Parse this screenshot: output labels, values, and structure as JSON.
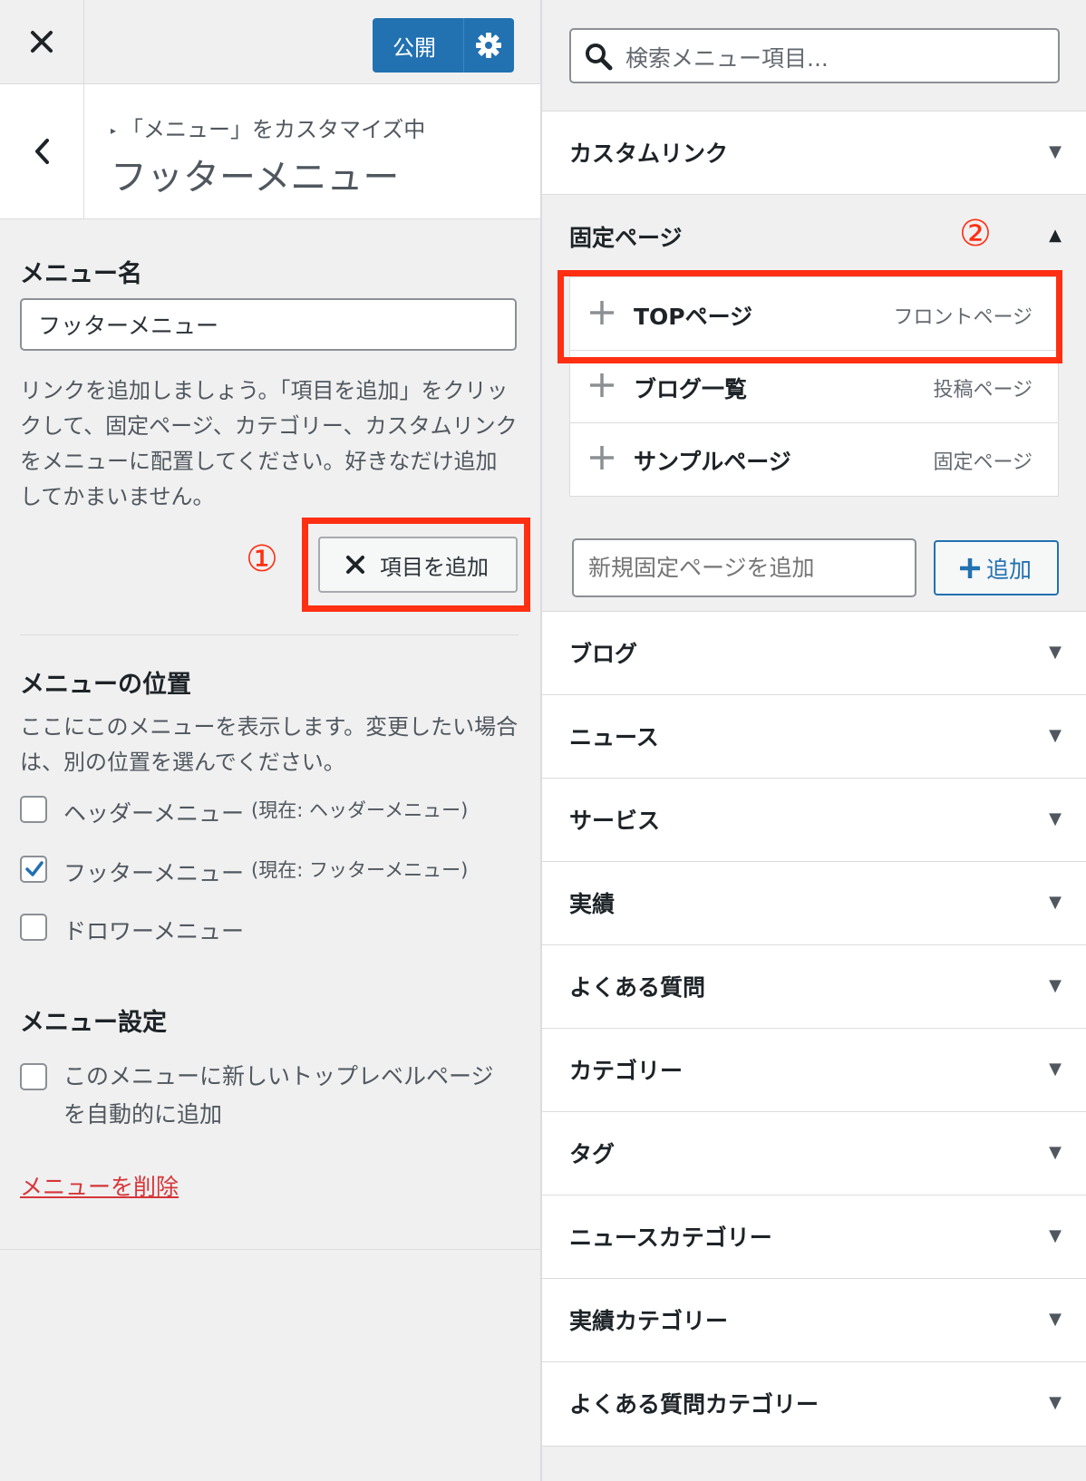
{
  "left": {
    "publish_label": "公開",
    "breadcrumb": "「メニュー」をカスタマイズ中",
    "panel_title": "フッターメニュー",
    "menu_name_heading": "メニュー名",
    "menu_name_value": "フッターメニュー",
    "help_text": "リンクを追加しましょう。「項目を追加」をクリックして、固定ページ、カテゴリー、カスタムリンクをメニューに配置してください。好きなだけ追加してかまいません。",
    "add_item_label": "項目を追加",
    "annotation_1": "①",
    "location_heading": "メニューの位置",
    "location_text": "ここにこのメニューを表示します。変更したい場合は、別の位置を選んでください。",
    "locations": [
      {
        "label": "ヘッダーメニュー",
        "current": "(現在: ヘッダーメニュー)",
        "checked": false
      },
      {
        "label": "フッターメニュー",
        "current": "(現在: フッターメニュー)",
        "checked": true
      },
      {
        "label": "ドロワーメニュー",
        "current": "",
        "checked": false
      }
    ],
    "settings_heading": "メニュー設定",
    "auto_add_label": "このメニューに新しいトップレベルページを自動的に追加",
    "delete_label": "メニューを削除"
  },
  "right": {
    "search_placeholder": "検索メニュー項目...",
    "custom_link": "カスタムリンク",
    "fixed_pages": {
      "title": "固定ページ",
      "annotation_2": "②",
      "items": [
        {
          "name": "TOPページ",
          "type": "フロントページ"
        },
        {
          "name": "ブログ一覧",
          "type": "投稿ページ"
        },
        {
          "name": "サンプルページ",
          "type": "固定ページ"
        }
      ],
      "new_page_placeholder": "新規固定ページを追加",
      "add_label": "追加"
    },
    "sections": [
      "ブログ",
      "ニュース",
      "サービス",
      "実績",
      "よくある質問",
      "カテゴリー",
      "タグ",
      "ニュースカテゴリー",
      "実績カテゴリー",
      "よくある質問カテゴリー"
    ]
  },
  "colors": {
    "accent": "#2271b1",
    "annotation": "#ff2f12",
    "danger": "#d63638"
  },
  "icons": [
    "close-icon",
    "gear-icon",
    "back-chevron-icon",
    "search-icon",
    "plus-icon",
    "x-icon",
    "checkmark-icon",
    "triangle-down-icon",
    "triangle-up-icon"
  ]
}
